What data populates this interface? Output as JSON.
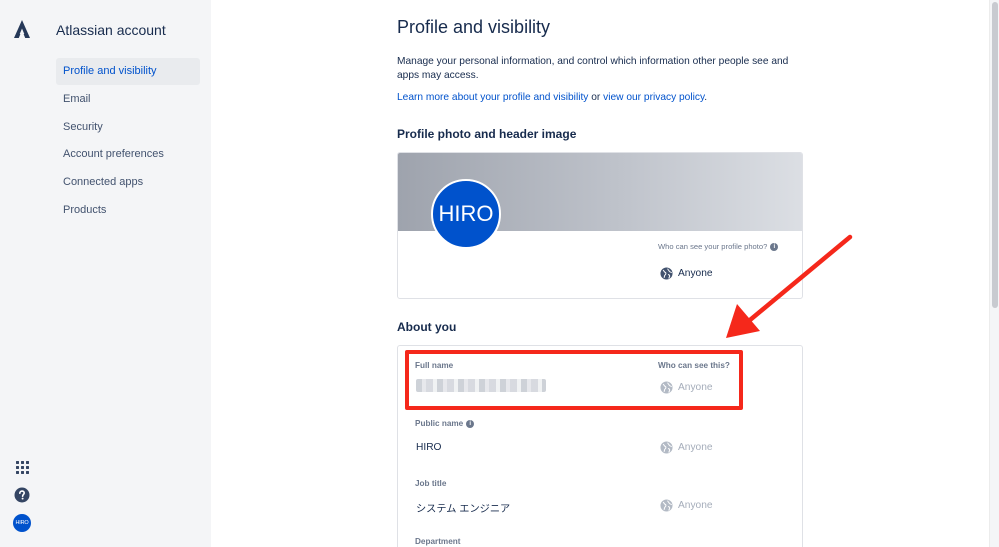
{
  "sidebar": {
    "title": "Atlassian account",
    "items": [
      {
        "label": "Profile and visibility"
      },
      {
        "label": "Email"
      },
      {
        "label": "Security"
      },
      {
        "label": "Account preferences"
      },
      {
        "label": "Connected apps"
      },
      {
        "label": "Products"
      }
    ],
    "avatar_text": "HIRO"
  },
  "main": {
    "title": "Profile and visibility",
    "intro": "Manage your personal information, and control which information other people see and apps may access.",
    "learn_link": "Learn more about your profile and visibility",
    "or_text": " or ",
    "privacy_link": "view our privacy policy",
    "period": ".",
    "photo_section": {
      "heading": "Profile photo and header image",
      "avatar_text": "HIRO",
      "who_label": "Who can see your profile photo?",
      "visibility": "Anyone"
    },
    "about_section": {
      "heading": "About you",
      "who_label": "Who can see this?",
      "fields": [
        {
          "label": "Full name",
          "value": "",
          "visibility": "Anyone"
        },
        {
          "label": "Public name",
          "value": "HIRO",
          "visibility": "Anyone"
        },
        {
          "label": "Job title",
          "value": "システム エンジニア",
          "visibility": "Anyone"
        },
        {
          "label": "Department"
        }
      ]
    }
  },
  "colors": {
    "brand_blue": "#0052CC",
    "annotation_red": "#F5281B",
    "sidebar_bg": "#F4F5F7"
  },
  "icons": [
    "atlassian-logo-icon",
    "app-switcher-icon",
    "help-icon",
    "globe-icon",
    "info-icon"
  ]
}
